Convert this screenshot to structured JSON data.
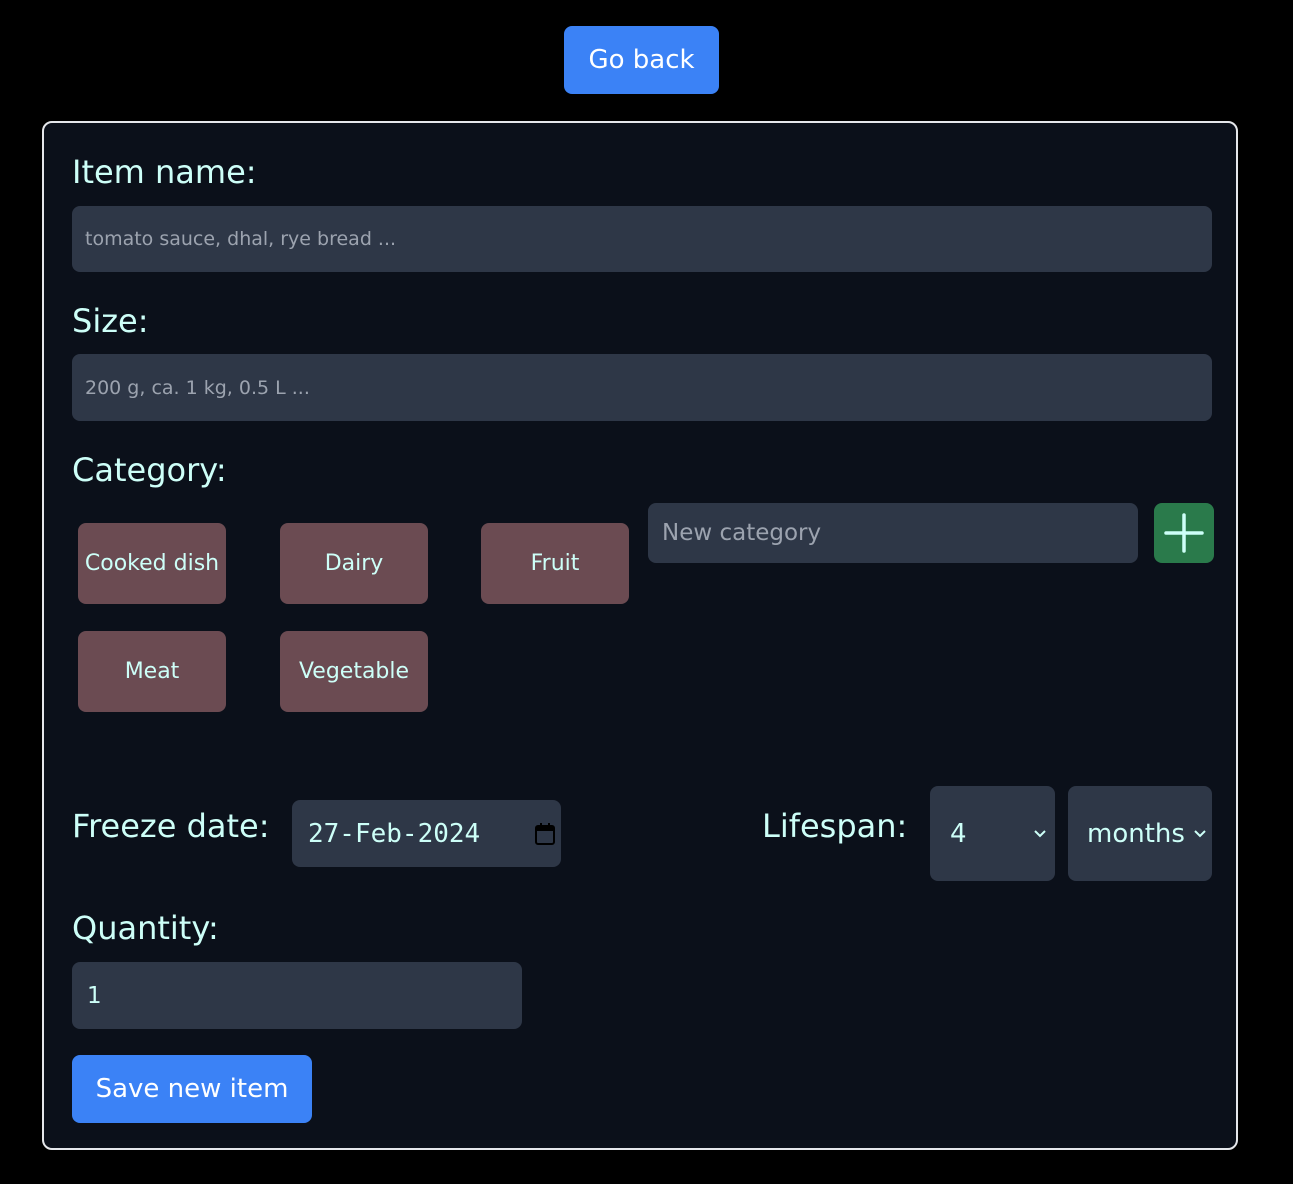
{
  "header": {
    "go_back_label": "Go back"
  },
  "form": {
    "item_name": {
      "label": "Item name:",
      "placeholder": "tomato sauce, dhal, rye bread ..."
    },
    "size": {
      "label": "Size:",
      "placeholder": "200 g, ca. 1 kg, 0.5 L ..."
    },
    "category": {
      "label": "Category:",
      "chips": [
        "Cooked dish",
        "Dairy",
        "Fruit",
        "Meat",
        "Vegetable"
      ],
      "new_placeholder": "New category",
      "add_icon": "plus-icon"
    },
    "freeze_date": {
      "label": "Freeze date:",
      "value": "27-Feb-2024",
      "icon": "calendar-icon"
    },
    "lifespan": {
      "label": "Lifespan:",
      "amount": "4",
      "unit": "months"
    },
    "quantity": {
      "label": "Quantity:",
      "value": "1"
    },
    "save_label": "Save new item"
  },
  "colors": {
    "primary": "#3b82f6",
    "chip": "#6b4b52",
    "add": "#2a7a4b",
    "field": "#2e3747",
    "text": "#cdfff8"
  }
}
